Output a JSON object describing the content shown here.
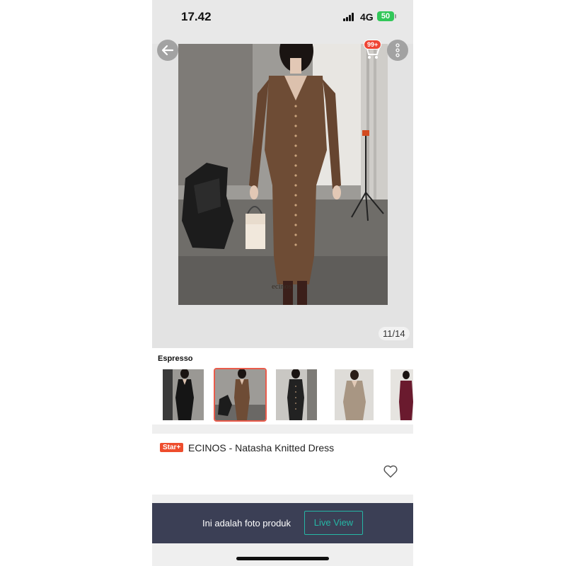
{
  "status_bar": {
    "time": "17.42",
    "network": "4G",
    "battery": "50"
  },
  "header": {
    "cart_badge": "99+"
  },
  "gallery": {
    "counter": "11/14",
    "watermark": "ecinos"
  },
  "variants": {
    "label": "Espresso",
    "thumbnails": [
      "Black",
      "Espresso",
      "Black with buttons",
      "Beige",
      "Maroon"
    ],
    "selected": "Espresso"
  },
  "product": {
    "badge": "Star+",
    "name": "ECINOS - Natasha Knitted Dress"
  },
  "banner": {
    "text": "Ini adalah foto produk",
    "button": "Live View"
  },
  "colors": {
    "accent": "#ee4d2d",
    "teal": "#26b7a6",
    "banner_bg": "#3b3f55",
    "dress_brown": "#6e4c35"
  },
  "icons": [
    "back-arrow-icon",
    "cart-icon",
    "more-icon",
    "heart-icon",
    "signal-icon",
    "battery-icon"
  ]
}
